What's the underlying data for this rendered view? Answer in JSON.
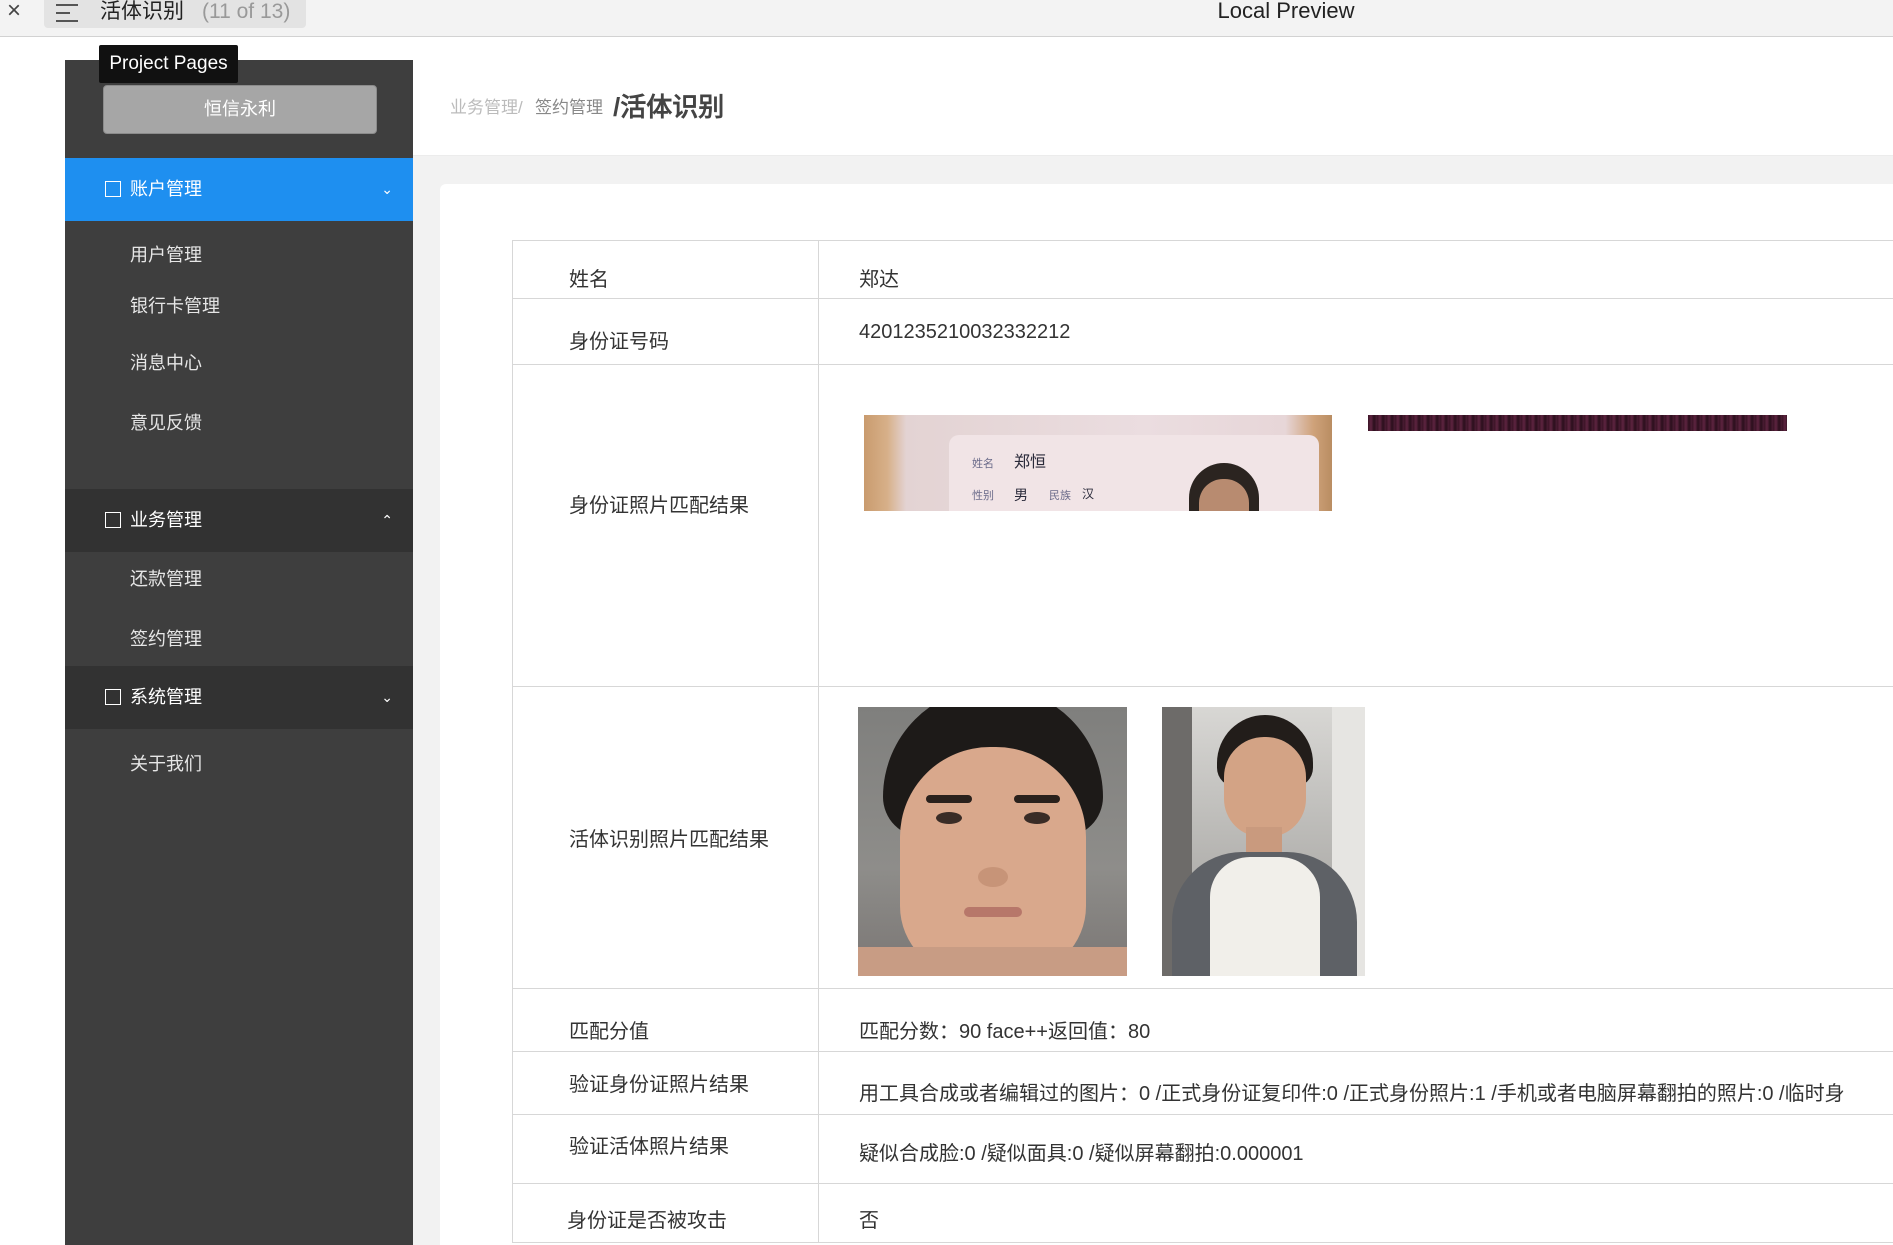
{
  "preview": {
    "close": "×",
    "page_name": "活体识别",
    "page_count": "(11 of 13)",
    "title": "Local Preview",
    "tooltip": "Project Pages"
  },
  "sidebar": {
    "brand": "恒信永利",
    "groups": [
      {
        "label": "账户管理",
        "chevron": "⌄",
        "items": [
          "用户管理",
          "银行卡管理",
          "消息中心",
          "意见反馈"
        ]
      },
      {
        "label": "业务管理",
        "chevron": "⌃",
        "items": [
          "还款管理",
          "签约管理"
        ]
      },
      {
        "label": "系统管理",
        "chevron": "⌄",
        "items": [
          "关于我们"
        ]
      }
    ]
  },
  "breadcrumb": {
    "level1": "业务管理/",
    "level2": "签约管理",
    "current": "/活体识别"
  },
  "detail": {
    "name_label": "姓名",
    "name_value": "郑达",
    "id_label": "身份证号码",
    "id_value": "4201235210032332212",
    "id_photo_label": "身份证照片匹配结果",
    "id_card_text": {
      "name_key": "姓名",
      "name_val": "郑恒",
      "gender_key": "性别",
      "gender_val": "男",
      "ethnic_key": "民族",
      "ethnic_val": "汉"
    },
    "live_photo_label": "活体识别照片匹配结果",
    "score_label": "匹配分值",
    "score_value": "匹配分数：90  face++返回值：80",
    "verify_id_label": "验证身份证照片结果",
    "verify_id_value": "用工具合成或者编辑过的图片：0 /正式身份证复印件:0 /正式身份照片:1 /手机或者电脑屏幕翻拍的照片:0 /临时身",
    "verify_live_label": "验证活体照片结果",
    "verify_live_value": "疑似合成脸:0 /疑似面具:0 /疑似屏幕翻拍:0.000001",
    "attack_label": "身份证是否被攻击",
    "attack_value": "否"
  },
  "colors": {
    "sidebar_bg": "#3e3e3e",
    "active_blue": "#1e8ff0",
    "group_dark": "#323232",
    "brand_btn": "#a6a6a6"
  }
}
